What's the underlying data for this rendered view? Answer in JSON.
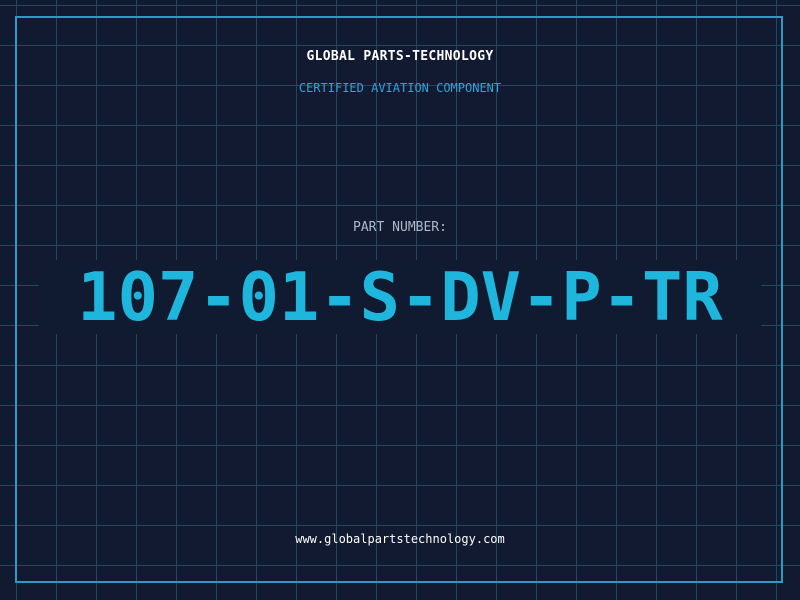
{
  "header": {
    "company_name": "GLOBAL PARTS-TECHNOLOGY",
    "tagline": "CERTIFIED AVIATION COMPONENT"
  },
  "part": {
    "label": "PART NUMBER:",
    "number": "107-01-S-DV-P-TR"
  },
  "footer": {
    "website": "www.globalpartstechnology.com"
  },
  "colors": {
    "background": "#111a30",
    "grid_line": "#1f4a5e",
    "frame_border": "#2a9cc4",
    "accent": "#1fb6dd",
    "label_text": "#aeb9c8",
    "primary_text": "#ffffff"
  }
}
